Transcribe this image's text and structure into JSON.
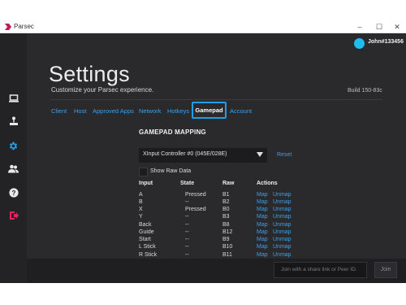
{
  "window": {
    "title": "Parsec",
    "controls": {
      "minimize": "–",
      "maximize": "☐",
      "close": "✕"
    }
  },
  "colors": {
    "accent": "#3aa0e8",
    "avatar": "#1ebcf0",
    "background": "#2a2a2d",
    "sidebar": "#232326"
  },
  "sidebar": {
    "items": [
      {
        "name": "computers-icon"
      },
      {
        "name": "arcade-icon"
      },
      {
        "name": "settings-gear-icon",
        "active": true
      },
      {
        "name": "friends-icon"
      },
      {
        "name": "help-icon"
      },
      {
        "name": "logout-icon"
      }
    ]
  },
  "user": {
    "name": "John#133456"
  },
  "header": {
    "title": "Settings",
    "subtitle": "Customize your Parsec experience.",
    "build": "Build 150-83c"
  },
  "tabs": [
    {
      "label": "Client"
    },
    {
      "label": "Host"
    },
    {
      "label": "Approved Apps"
    },
    {
      "label": "Network"
    },
    {
      "label": "Hotkeys"
    },
    {
      "label": "Gamepad",
      "active": true
    },
    {
      "label": "Account"
    }
  ],
  "gamepad": {
    "section_title": "GAMEPAD MAPPING",
    "controller": "XInput Controller #0 (045E/028E)",
    "reset_label": "Reset",
    "show_raw_label": "Show Raw Data",
    "columns": [
      "Input",
      "State",
      "Raw",
      "Actions"
    ],
    "rows": [
      {
        "input": "A",
        "state": "Pressed",
        "raw": "B1",
        "map": "Map",
        "unmap": "Unmap"
      },
      {
        "input": "B",
        "state": "--",
        "raw": "B2",
        "map": "Map",
        "unmap": "Unmap"
      },
      {
        "input": "X",
        "state": "Pressed",
        "raw": "B0",
        "map": "Map",
        "unmap": "Unmap"
      },
      {
        "input": "Y",
        "state": "--",
        "raw": "B3",
        "map": "Map",
        "unmap": "Unmap"
      },
      {
        "input": "Back",
        "state": "--",
        "raw": "B8",
        "map": "Map",
        "unmap": "Unmap"
      },
      {
        "input": "Guide",
        "state": "--",
        "raw": "B12",
        "map": "Map",
        "unmap": "Unmap"
      },
      {
        "input": "Start",
        "state": "--",
        "raw": "B9",
        "map": "Map",
        "unmap": "Unmap"
      },
      {
        "input": "L Stick",
        "state": "--",
        "raw": "B10",
        "map": "Map",
        "unmap": "Unmap"
      },
      {
        "input": "R Stick",
        "state": "--",
        "raw": "B11",
        "map": "Map",
        "unmap": "Unmap"
      }
    ]
  },
  "footer": {
    "join_placeholder": "Join with a share link or Peer ID.",
    "join_button": "Join"
  }
}
